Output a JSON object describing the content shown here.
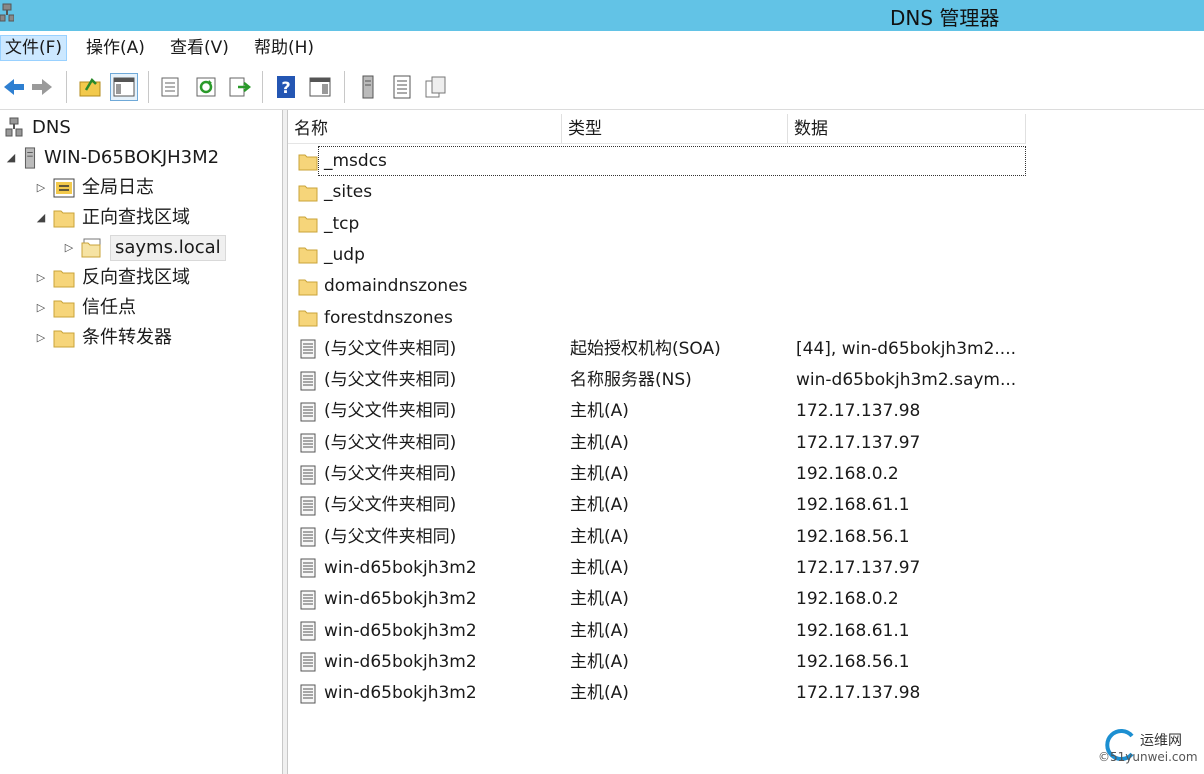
{
  "window": {
    "title": "DNS 管理器"
  },
  "menu": [
    {
      "label": "文件(F)",
      "active": true
    },
    {
      "label": "操作(A)",
      "active": false
    },
    {
      "label": "查看(V)",
      "active": false
    },
    {
      "label": "帮助(H)",
      "active": false
    }
  ],
  "toolbar": {
    "icons": [
      "back-arrow-icon",
      "forward-arrow-icon",
      "up-folder-icon",
      "show-hide-tree-icon",
      "properties-icon",
      "refresh-icon",
      "export-list-icon",
      "help-icon",
      "show-hide-action-pane-icon",
      "server-icon",
      "list-icon",
      "copy-icon"
    ]
  },
  "tree": {
    "root": "DNS",
    "server": "WIN-D65BOKJH3M2",
    "nodes": [
      {
        "label": "全局日志",
        "icon": "log-icon"
      },
      {
        "label": "正向查找区域",
        "icon": "folder-icon"
      },
      {
        "label": "sayms.local",
        "icon": "zone-icon"
      },
      {
        "label": "反向查找区域",
        "icon": "folder-icon"
      },
      {
        "label": "信任点",
        "icon": "folder-icon"
      },
      {
        "label": "条件转发器",
        "icon": "folder-icon"
      }
    ]
  },
  "list": {
    "columns": [
      "名称",
      "类型",
      "数据"
    ],
    "rows": [
      {
        "name": "_msdcs",
        "type": "",
        "data": "",
        "icon": "folder-icon"
      },
      {
        "name": "_sites",
        "type": "",
        "data": "",
        "icon": "folder-icon"
      },
      {
        "name": "_tcp",
        "type": "",
        "data": "",
        "icon": "folder-icon"
      },
      {
        "name": "_udp",
        "type": "",
        "data": "",
        "icon": "folder-icon"
      },
      {
        "name": "domaindnszones",
        "type": "",
        "data": "",
        "icon": "folder-icon"
      },
      {
        "name": "forestdnszones",
        "type": "",
        "data": "",
        "icon": "folder-icon"
      },
      {
        "name": "(与父文件夹相同)",
        "type": "起始授权机构(SOA)",
        "data": "[44], win-d65bokjh3m2....",
        "icon": "record-icon"
      },
      {
        "name": "(与父文件夹相同)",
        "type": "名称服务器(NS)",
        "data": "win-d65bokjh3m2.saym...",
        "icon": "record-icon"
      },
      {
        "name": "(与父文件夹相同)",
        "type": "主机(A)",
        "data": "172.17.137.98",
        "icon": "record-icon"
      },
      {
        "name": "(与父文件夹相同)",
        "type": "主机(A)",
        "data": "172.17.137.97",
        "icon": "record-icon"
      },
      {
        "name": "(与父文件夹相同)",
        "type": "主机(A)",
        "data": "192.168.0.2",
        "icon": "record-icon"
      },
      {
        "name": "(与父文件夹相同)",
        "type": "主机(A)",
        "data": "192.168.61.1",
        "icon": "record-icon"
      },
      {
        "name": "(与父文件夹相同)",
        "type": "主机(A)",
        "data": "192.168.56.1",
        "icon": "record-icon"
      },
      {
        "name": "win-d65bokjh3m2",
        "type": "主机(A)",
        "data": "172.17.137.97",
        "icon": "record-icon"
      },
      {
        "name": "win-d65bokjh3m2",
        "type": "主机(A)",
        "data": "192.168.0.2",
        "icon": "record-icon"
      },
      {
        "name": "win-d65bokjh3m2",
        "type": "主机(A)",
        "data": "192.168.61.1",
        "icon": "record-icon"
      },
      {
        "name": "win-d65bokjh3m2",
        "type": "主机(A)",
        "data": "192.168.56.1",
        "icon": "record-icon"
      },
      {
        "name": "win-d65bokjh3m2",
        "type": "主机(A)",
        "data": "172.17.137.98",
        "icon": "record-icon"
      }
    ]
  },
  "watermark": {
    "text": "运维网",
    "sub": "©51yunwei.com"
  },
  "colors": {
    "titlebar": "#62c3e6",
    "menu_active": "#cce8ff",
    "folder": "#f6d57a"
  }
}
